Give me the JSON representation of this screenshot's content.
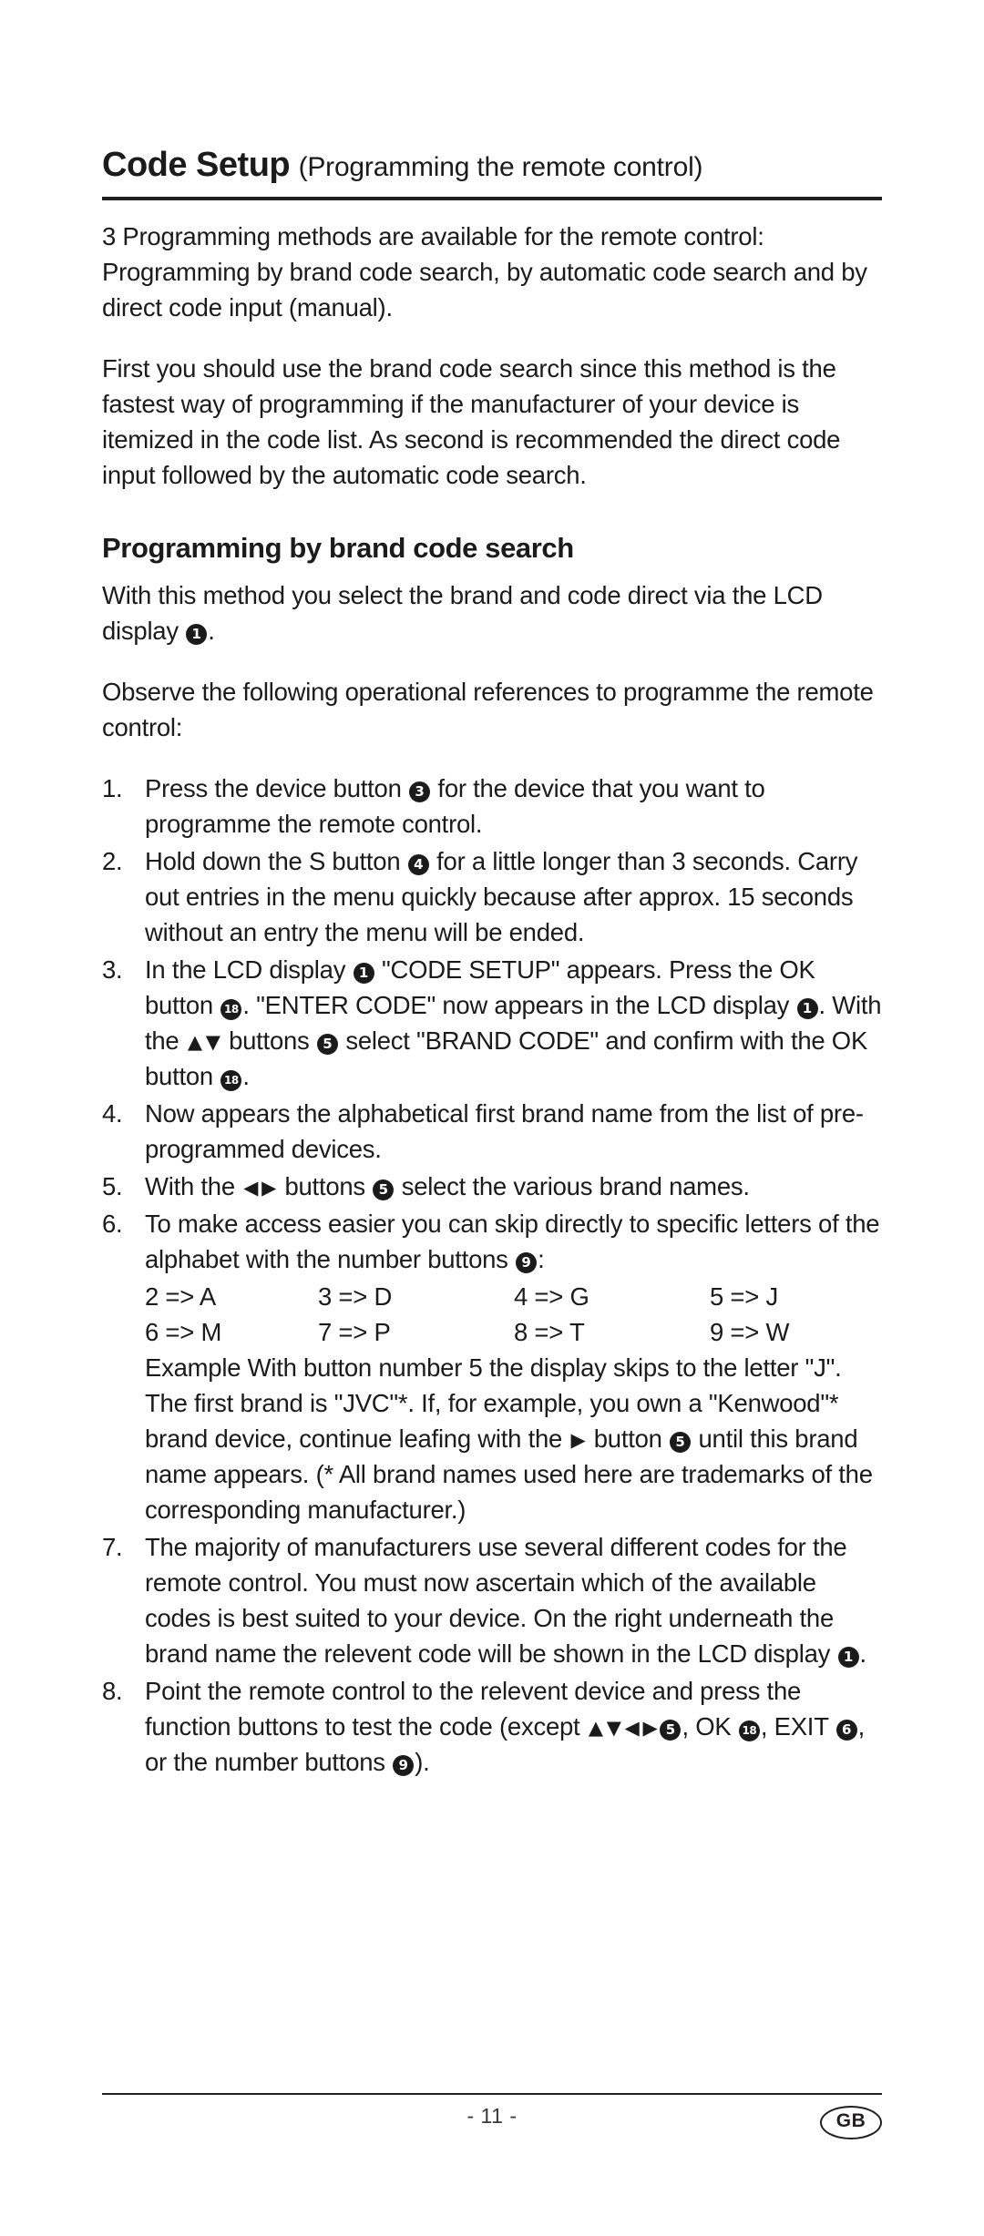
{
  "header": {
    "title_main": "Code Setup",
    "title_sub": "(Programming the remote control)"
  },
  "intro": {
    "paragraph_1": "3 Programming methods are available for the remote control: Programming by brand code search, by automatic code search and by direct code input (manual).",
    "paragraph_2": "First you should use the brand code search since this method is the fastest way of programming if the manufacturer of your device is itemized in the code list. As second is recommended the direct code input followed by the automatic code search."
  },
  "section": {
    "heading": "Programming by brand code search",
    "paragraph_1a": "With this method you select the brand and code direct via the LCD display ",
    "paragraph_1b": ".",
    "paragraph_2": "Observe the following operational references to programme the remote control:"
  },
  "steps": {
    "s1_num": "1.",
    "s1_a": "Press the device button ",
    "s1_b": " for the device that you want to programme the remote control.",
    "s2_num": "2.",
    "s2_a": "Hold down the S button ",
    "s2_b": " for a little longer than 3 seconds. Carry out entries in the menu quickly because after approx. 15 seconds without an entry the menu will be ended.",
    "s3_num": "3.",
    "s3_a": "In the LCD display ",
    "s3_b": " \"CODE SETUP\" appears. Press the OK button ",
    "s3_c": ". \"ENTER CODE\" now appears in the LCD display ",
    "s3_d": ". With the ",
    "s3_e": " buttons ",
    "s3_f": " select \"BRAND CODE\" and confirm with the OK button ",
    "s3_g": ".",
    "s4_num": "4.",
    "s4_text": "Now appears the alphabetical first brand name from the list of pre-programmed devices.",
    "s5_num": "5.",
    "s5_a": "With the ",
    "s5_b": " buttons ",
    "s5_c": " select the various brand names.",
    "s6_num": "6.",
    "s6_a": "To make access easier you can skip directly to specific letters of the alphabet with the number buttons ",
    "s6_b": ":",
    "s6_example_a": "Example With button number 5 the display skips to the letter \"J\". The first brand is \"JVC\"*. If, for example, you own a \"Kenwood\"* brand device, continue leafing with the ",
    "s6_example_b": " button ",
    "s6_example_c": " until this brand name appears. (* All brand names used here are trademarks of the corresponding manufacturer.)",
    "s7_num": "7.",
    "s7_a": "The majority of manufacturers use several different codes for the remote control. You must now ascertain which of the available codes is best suited to your device. On the right underneath the brand name the relevent code will be shown in the LCD display ",
    "s7_b": ".",
    "s8_num": "8.",
    "s8_a": "Point the remote control to the relevent device and press the function buttons to test the code (except ",
    "s8_b": " ",
    "s8_c": ", OK ",
    "s8_d": ", EXIT ",
    "s8_e": ", or the number buttons ",
    "s8_f": ")."
  },
  "letter_map": {
    "rows": [
      {
        "c1": "2 => A",
        "c2": "3 => D",
        "c3": "4 => G",
        "c4": "5 => J"
      },
      {
        "c1": "6 => M",
        "c2": "7 => P",
        "c3": "8 => T",
        "c4": "9 => W"
      }
    ]
  },
  "markers": {
    "one": "1",
    "three": "3",
    "four": "4",
    "five": "5",
    "six": "6",
    "nine": "9",
    "eighteen": "18"
  },
  "arrows": {
    "up": "▲",
    "down": "▼",
    "left": "◀",
    "right": "▶"
  },
  "footer": {
    "page_number": "- 11 -",
    "language_badge": "GB"
  },
  "colors": {
    "text": "#1b1b1b",
    "rule": "#231f20",
    "background": "#ffffff"
  }
}
